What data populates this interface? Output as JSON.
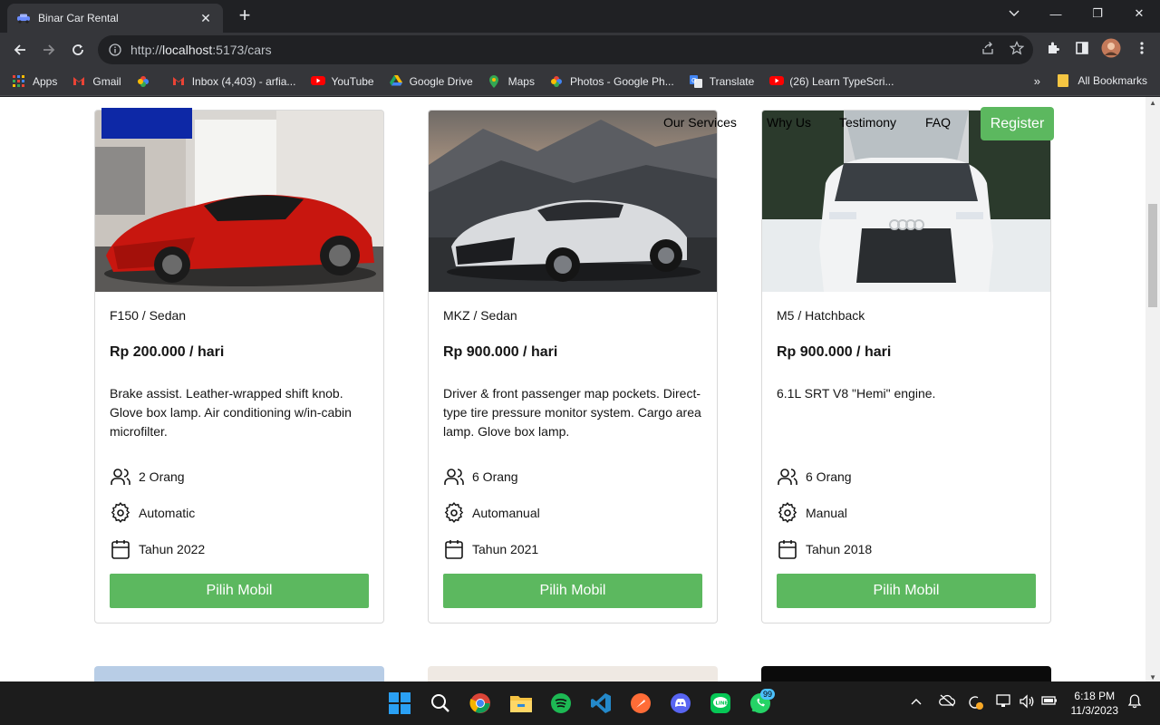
{
  "browser": {
    "tab_title": "Binar Car Rental",
    "tab_close": "✕",
    "new_tab": "+",
    "url_scheme": "http://",
    "url_host": "localhost",
    "url_rest": ":5173/cars",
    "window_controls": [
      "—",
      "❐",
      "✕"
    ]
  },
  "bookmarks": {
    "items": [
      {
        "label": "Apps",
        "icon": "apps-grid-icon",
        "color": "#ea4335"
      },
      {
        "label": "Gmail",
        "icon": "gmail-icon",
        "color": "#ea4335"
      },
      {
        "label": "",
        "icon": "photos-icon",
        "color": "#fbbc04"
      },
      {
        "label": "Inbox (4,403) - arfia...",
        "icon": "gmail-icon",
        "color": "#ea4335"
      },
      {
        "label": "YouTube",
        "icon": "youtube-icon",
        "color": "#ff0000"
      },
      {
        "label": "Google Drive",
        "icon": "drive-icon",
        "color": "#1fa463"
      },
      {
        "label": "Maps",
        "icon": "maps-icon",
        "color": "#34a853"
      },
      {
        "label": "Photos - Google Ph...",
        "icon": "photos-icon",
        "color": "#fbbc04"
      },
      {
        "label": "Translate",
        "icon": "translate-icon",
        "color": "#4285f4"
      },
      {
        "label": "(26) Learn TypeScri...",
        "icon": "youtube-icon",
        "color": "#ff0000"
      }
    ],
    "more": "»",
    "all_bookmarks": "All Bookmarks"
  },
  "header": {
    "nav": [
      "Our Services",
      "Why Us",
      "Testimony",
      "FAQ"
    ],
    "register": "Register"
  },
  "cars": [
    {
      "name": "F150 / Sedan",
      "price": "Rp 200.000 / hari",
      "description": "Brake assist. Leather-wrapped shift knob. Glove box lamp. Air conditioning w/in-cabin microfilter.",
      "capacity": "2 Orang",
      "transmission": "Automatic",
      "year": "Tahun 2022",
      "button": "Pilih Mobil"
    },
    {
      "name": "MKZ / Sedan",
      "price": "Rp 900.000 / hari",
      "description": "Driver & front passenger map pockets. Direct-type tire pressure monitor system. Cargo area lamp. Glove box lamp.",
      "capacity": "6 Orang",
      "transmission": "Automanual",
      "year": "Tahun 2021",
      "button": "Pilih Mobil"
    },
    {
      "name": "M5 / Hatchback",
      "price": "Rp 900.000 / hari",
      "description": "6.1L SRT V8 \"Hemi\" engine.",
      "capacity": "6 Orang",
      "transmission": "Manual",
      "year": "Tahun 2018",
      "button": "Pilih Mobil"
    }
  ],
  "taskbar": {
    "time": "6:18 PM",
    "date": "11/3/2023",
    "whatsapp_badge": "99"
  },
  "colors": {
    "accent_green": "#5cb85f",
    "brand_blue": "#0d28a6"
  }
}
